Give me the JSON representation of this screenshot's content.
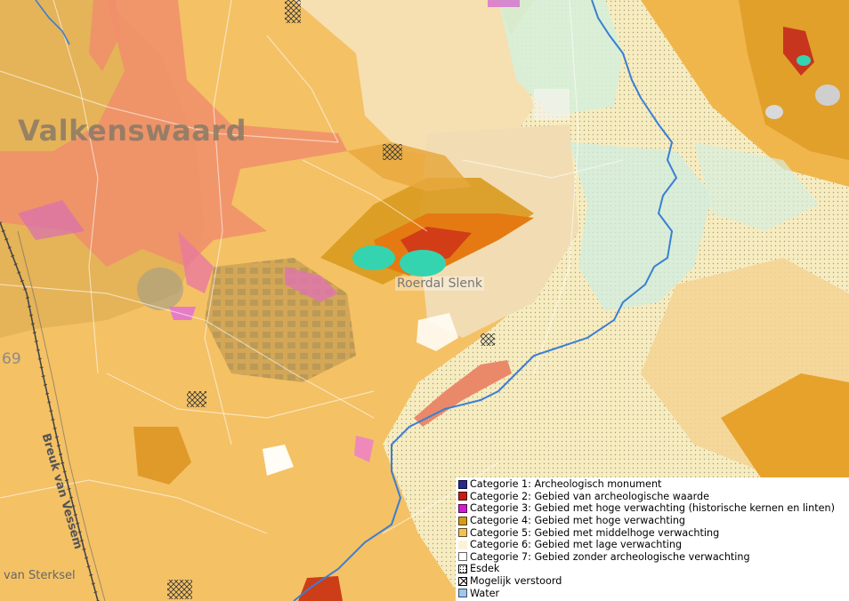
{
  "map": {
    "labels": {
      "town": "Valkenswaard",
      "area": "Roerdal Slenk",
      "road": "Breuk van Vessem",
      "road_partial": "van Sterksel",
      "number": "69"
    }
  },
  "legend": {
    "items": [
      {
        "label": "Categorie 1: Archeologisch monument",
        "color": "#2a2a8c"
      },
      {
        "label": "Categorie 2: Gebied van archeologische waarde",
        "color": "#c81e12"
      },
      {
        "label": "Categorie 3: Gebied met hoge verwachting (historische kernen en linten)",
        "color": "#d01bd0"
      },
      {
        "label": "Categorie 4: Gebied met hoge verwachting",
        "color": "#d49b18"
      },
      {
        "label": "Categorie 5: Gebied met middelhoge verwachting",
        "color": "#f2c15b"
      },
      {
        "label": "Categorie 6: Gebied met lage verwachting",
        "color": "#fbf3d8"
      },
      {
        "label": "Categorie 7: Gebied zonder archeologische verwachting",
        "color": "#ffffff"
      },
      {
        "label": "Esdek",
        "color": "#ffffff"
      },
      {
        "label": "Mogelijk verstoord",
        "color": "#ffffff"
      },
      {
        "label": "Water",
        "color": "#9ec6ef"
      }
    ]
  }
}
